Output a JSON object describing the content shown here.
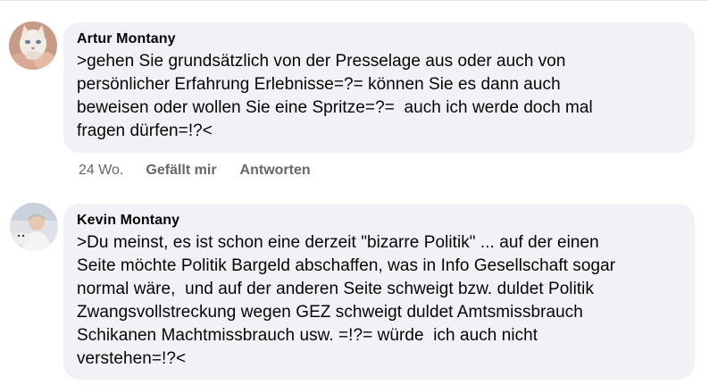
{
  "comments": [
    {
      "author": "Artur Montany",
      "text": ">gehen Sie grundsätzlich von der Presselage aus oder auch von\npersönlicher Erfahrung Erlebnisse=?= können Sie es dann auch\nbeweisen oder wollen Sie eine Spritze=?=  auch ich werde doch mal\nfragen dürfen=!?<",
      "avatar_icon": "cat-photo-avatar",
      "time": "24 Wo.",
      "like_label": "Gefällt mir",
      "reply_label": "Antworten"
    },
    {
      "author": "Kevin Montany",
      "text": ">Du meinst, es ist schon eine derzeit \"bizarre Politik\" ... auf der einen\nSeite möchte Politik Bargeld abschaffen, was in Info Gesellschaft sogar\nnormal wäre,  und auf der anderen Seite schweigt bzw. duldet Politik\nZwangsvollstreckung wegen GEZ schweigt duldet Amtsmissbrauch\nSchikanen Machtmissbrauch usw. =!?= würde  ich auch nicht\nverstehen=!?<",
      "avatar_icon": "person-photo-avatar"
    }
  ],
  "colors": {
    "bubble": "#f0f2f5",
    "meta_text": "#65676b",
    "body_text": "#050505"
  }
}
